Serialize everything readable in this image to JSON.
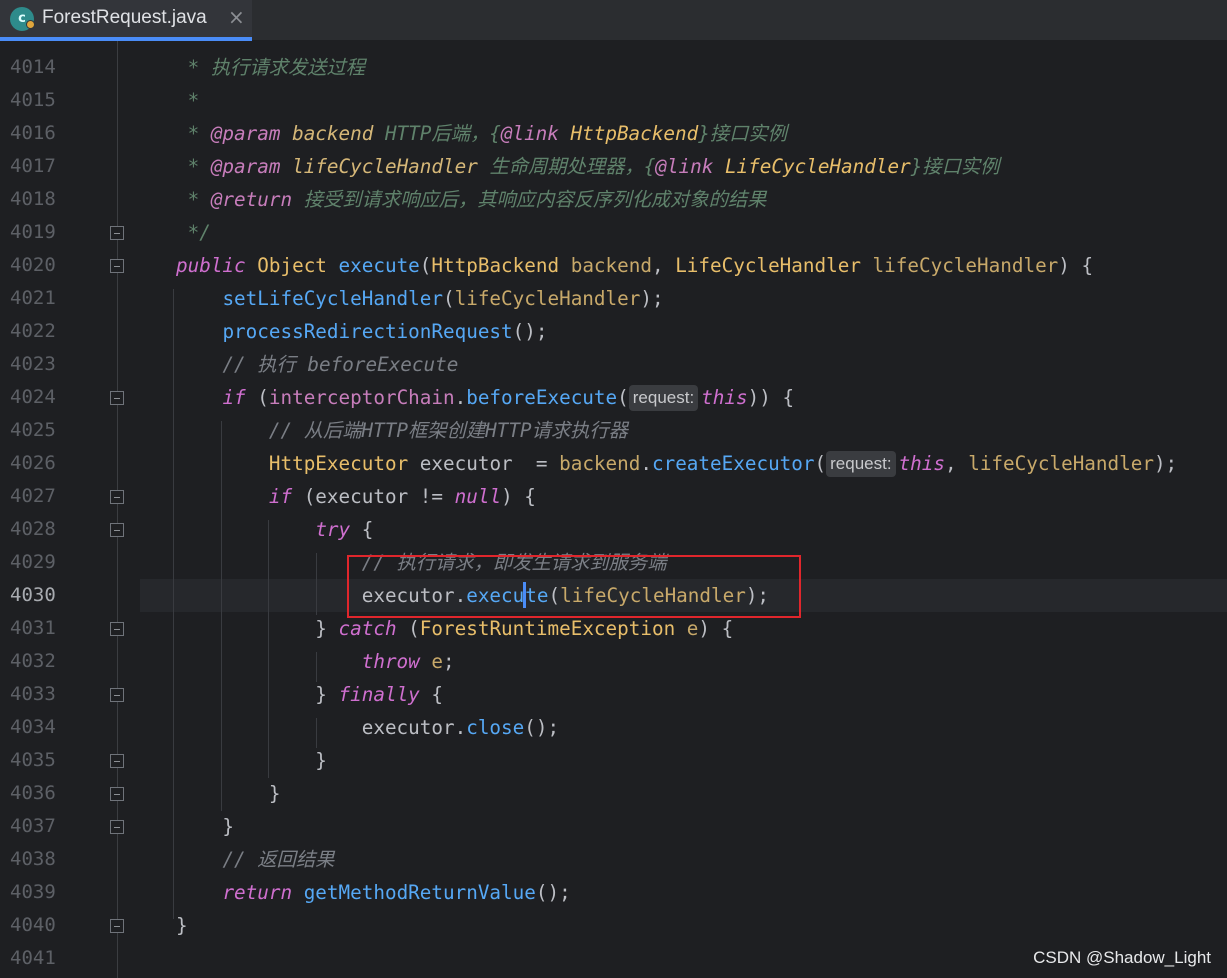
{
  "tab": {
    "title": "ForestRequest.java",
    "icon_letter": "c",
    "close_glyph": "×"
  },
  "lines": [
    "4014",
    "4015",
    "4016",
    "4017",
    "4018",
    "4019",
    "4020",
    "4021",
    "4022",
    "4023",
    "4024",
    "4025",
    "4026",
    "4027",
    "4028",
    "4029",
    "4030",
    "4031",
    "4032",
    "4033",
    "4034",
    "4035",
    "4036",
    "4037",
    "4038",
    "4039",
    "4040",
    "4041"
  ],
  "current_line": "4030",
  "code": {
    "l4014": "执行请求发送过程",
    "l4016_desc": "HTTP后端，",
    "l4016_link": "HttpBackend",
    "l4016_tail": "接口实例",
    "l4017_desc": "生命周期处理器，",
    "l4017_link": "LifeCycleHandler",
    "l4017_tail": "接口实例",
    "l4018_desc": "接受到请求响应后，其响应内容反序列化成对象的结果",
    "c4023": "// 执行 beforeExecute",
    "c4025": "// 从后端HTTP框架创建HTTP请求执行器",
    "c4029": "// 执行请求，即发生请求到服务端",
    "c4038": "// 返回结果",
    "hint_request": "request:"
  },
  "watermark": "CSDN @Shadow_Light",
  "colors": {
    "accent": "#4a8cf7",
    "highlight_box": "#e0262c"
  }
}
